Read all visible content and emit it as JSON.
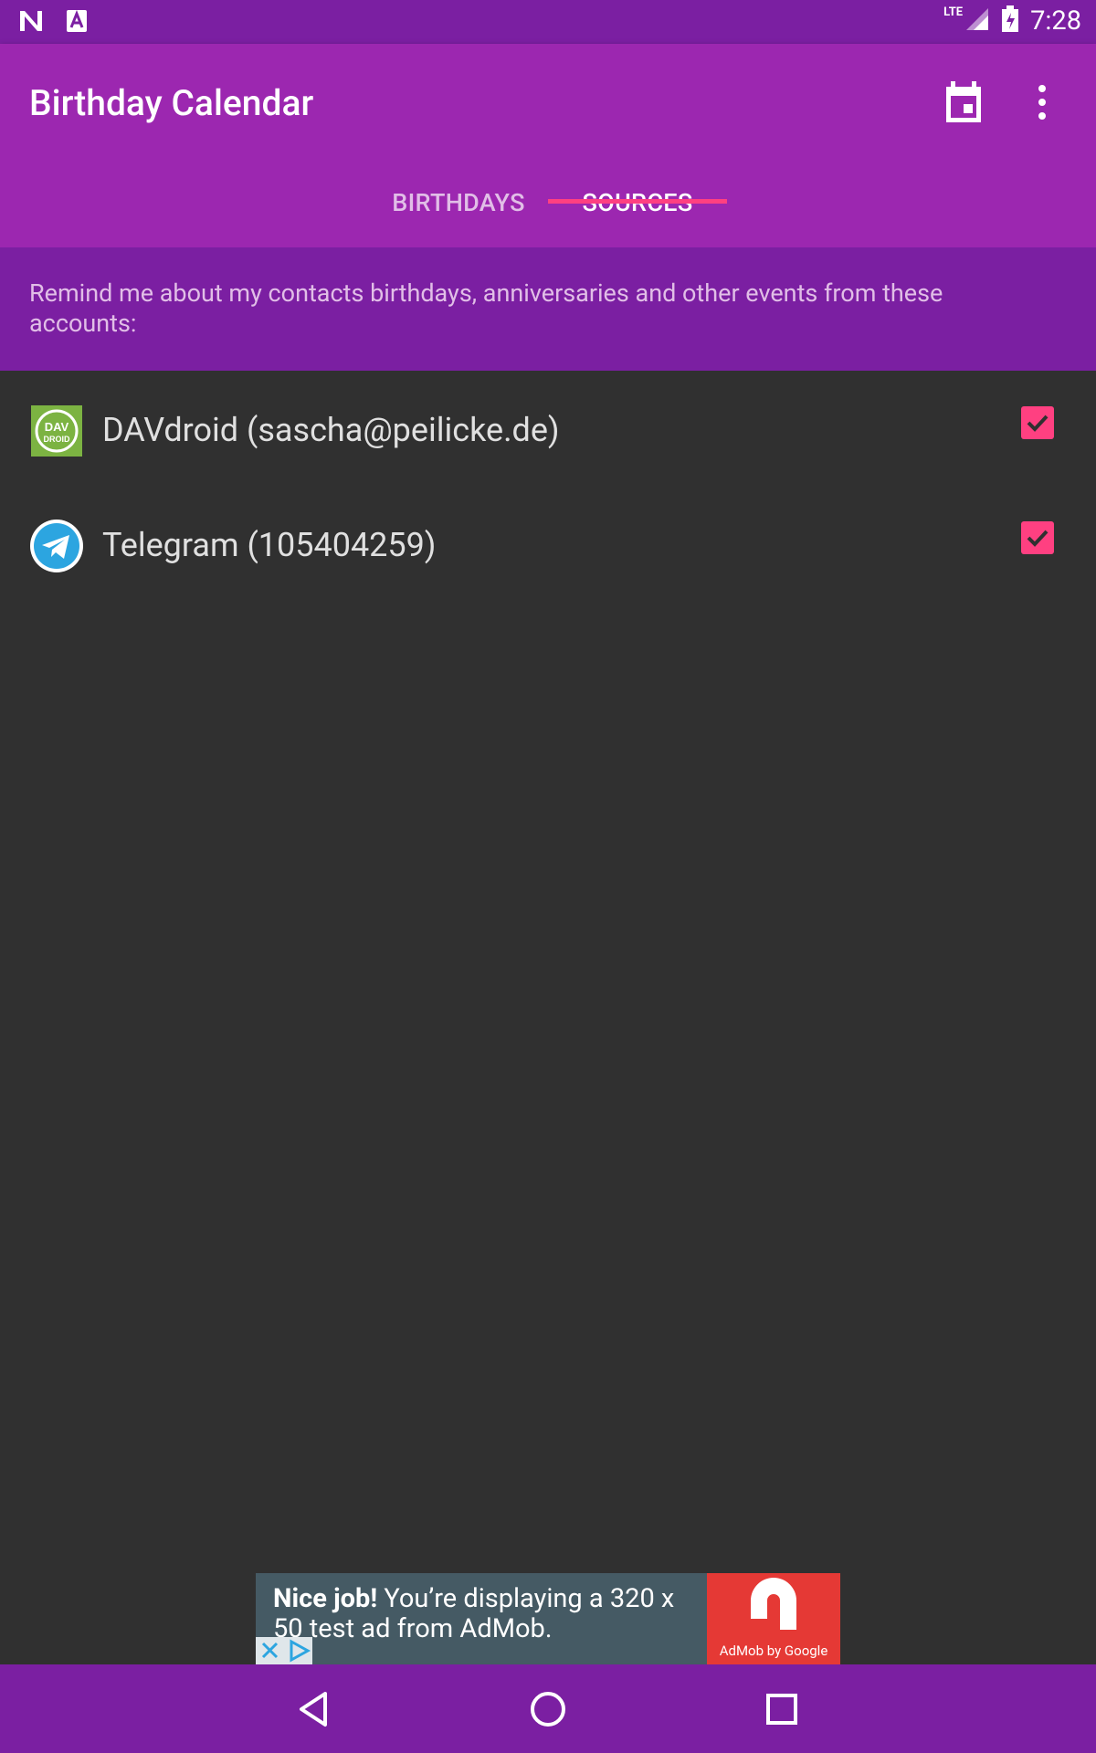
{
  "status_bar": {
    "left_icons": [
      "n-logo-icon",
      "a-badge-icon"
    ],
    "network": "LTE",
    "time": "7:28"
  },
  "app_bar": {
    "title": "Birthday Calendar",
    "actions": [
      "calendar-icon",
      "more-vert-icon"
    ]
  },
  "tabs": [
    {
      "label": "BIRTHDAYS",
      "selected": false
    },
    {
      "label": "SOURCES",
      "selected": true
    }
  ],
  "info_text": "Remind me about my contacts birthdays, anniversaries and other events from these accounts:",
  "sources": [
    {
      "label": "DAVdroid (sascha@peilicke.de)",
      "icon": "davdroid-icon",
      "icon_text_1": "DAV",
      "icon_text_2": "DROID",
      "checked": true
    },
    {
      "label": "Telegram (105404259)",
      "icon": "telegram-icon",
      "checked": true
    }
  ],
  "ad": {
    "headline": "Nice job!",
    "body": " You’re displaying a 320 x 50 test ad from AdMob.",
    "brand": "AdMob by Google"
  },
  "nav_bar": [
    "back-icon",
    "home-icon",
    "recents-icon"
  ],
  "colors": {
    "status_bar": "#7B1FA2",
    "app_bar": "#9C27B0",
    "accent": "#FF4081",
    "background": "#303030"
  }
}
